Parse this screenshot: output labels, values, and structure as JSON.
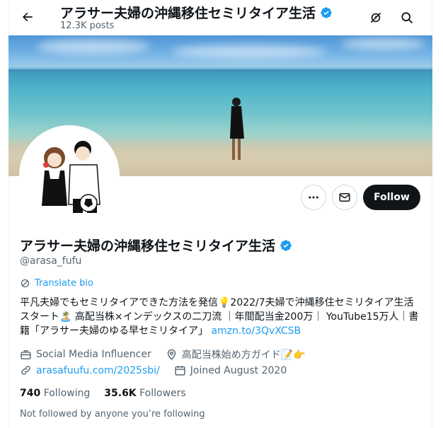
{
  "header": {
    "title": "アラサー夫婦の沖縄移住セミリタイア生活",
    "posts_count": "12.3K posts"
  },
  "profile": {
    "name": "アラサー夫婦の沖縄移住セミリタイア生活",
    "handle": "@arasa_fufu",
    "translate_label": "Translate bio",
    "bio_text": "平凡夫婦でもセミリタイアできた方法を発信💡2022/7夫婦で沖縄移住セミリタイア生活スタート🏝️ 高配当株×インデックスの二刀流 ｜年間配当金200万｜ YouTube15万人｜書籍「アラサー夫婦のゆる早セミリタイア」",
    "bio_link": "amzn.to/3QvXCSB",
    "category": "Social Media Influencer",
    "location": "高配当株始め方ガイド📝👉",
    "website": "arasafuufu.com/2025sbi/",
    "joined": "Joined August 2020",
    "following_count": "740",
    "following_label": "Following",
    "followers_count": "35.6K",
    "followers_label": "Followers",
    "not_followed": "Not followed by anyone you’re following"
  },
  "buttons": {
    "follow_label": "Follow"
  },
  "icons": {
    "back": "back-arrow-icon",
    "top_right_1": "no-notification-icon",
    "top_right_2": "search-icon",
    "more": "more-icon",
    "message": "mail-icon",
    "verified": "verified-badge-icon",
    "translate": "translate-icon",
    "category": "briefcase-icon",
    "location": "location-icon",
    "website": "link-icon",
    "joined": "calendar-icon"
  },
  "colors": {
    "accent": "#1d9bf0",
    "text": "#0f1419",
    "secondary_text": "#536471",
    "follow_button": "#0f1419"
  }
}
